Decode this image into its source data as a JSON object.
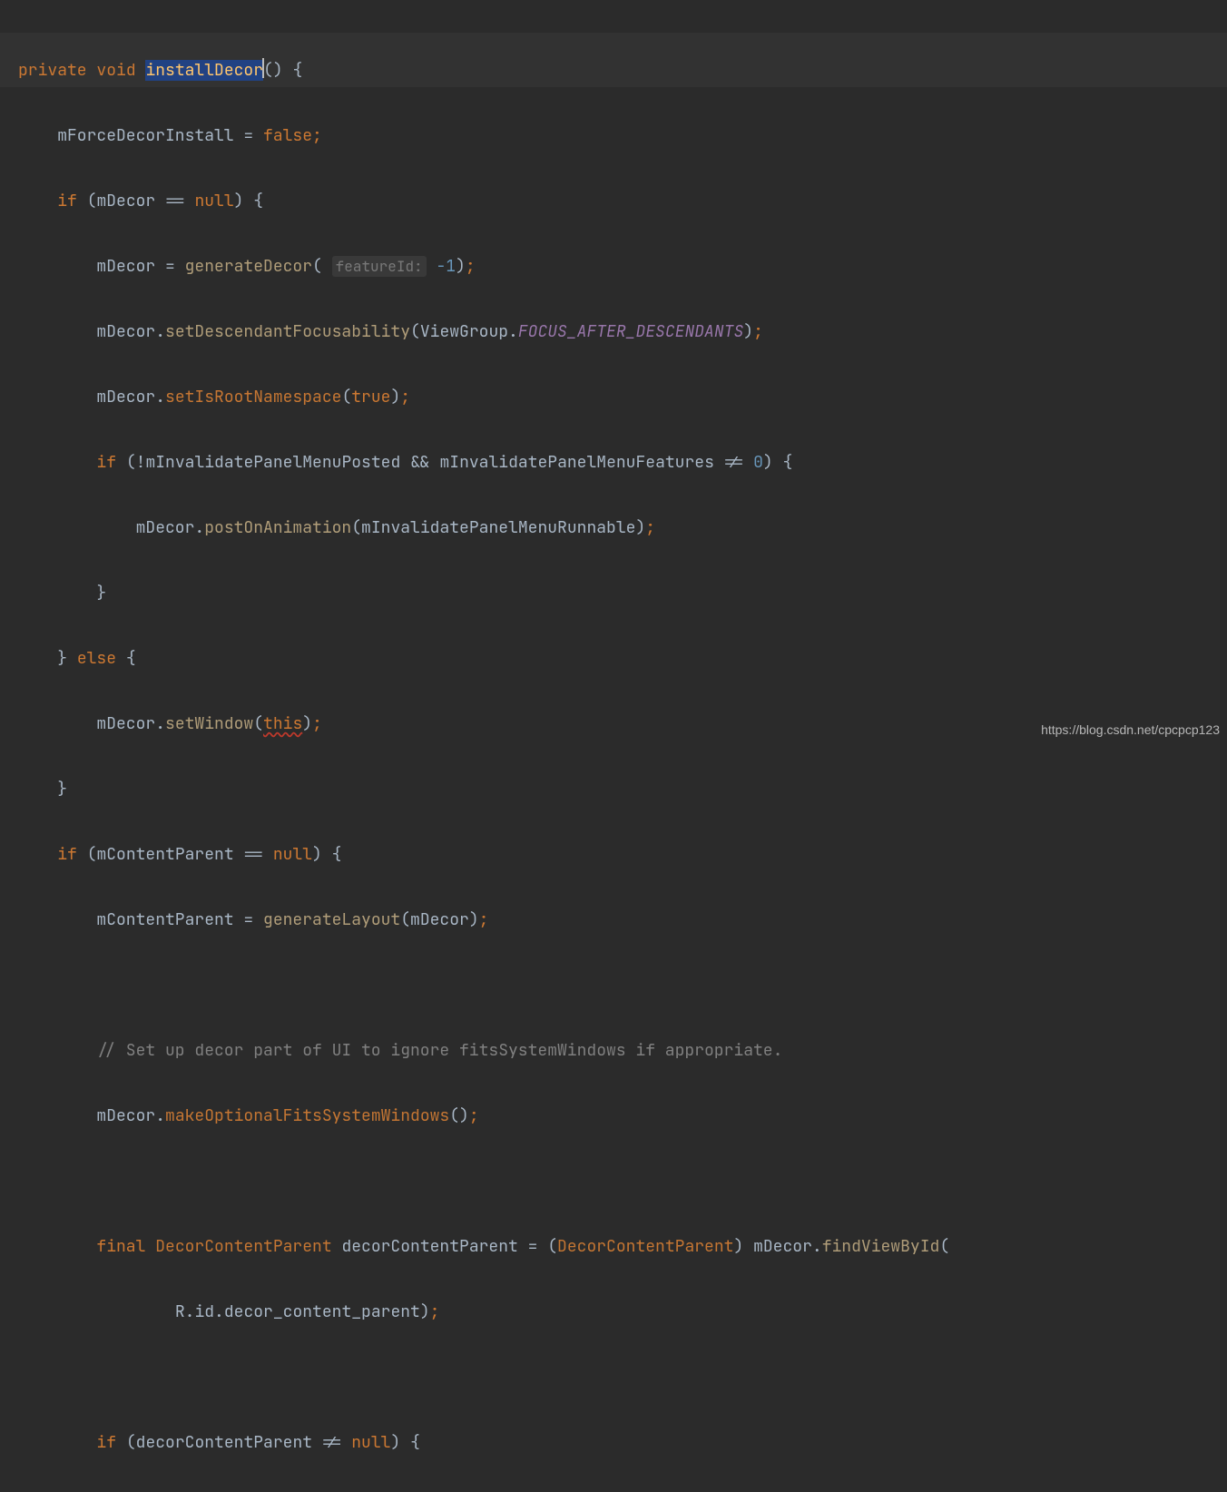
{
  "code": {
    "keyword_private": "private",
    "keyword_void": "void",
    "method_name": "installDecor",
    "open_paren": "()",
    "brace_open": " {",
    "l2_lhs": "mForceDecorInstall",
    "l2_eq": " = ",
    "kw_false": "false",
    "kw_if": "if",
    "kw_else": "else",
    "kw_null": "null",
    "kw_true": "true",
    "kw_this": "this",
    "kw_final": "final",
    "l3_cond_var": "mDecor",
    "l3_cond_op": " == ",
    "l4_lhs": "mDecor",
    "l4_eq": " = ",
    "l4_call": "generateDecor",
    "l4_hint": "featureId:",
    "l4_arg": " -1",
    "l5_obj": "mDecor",
    "l5_dot": ".",
    "l5_call": "setDescendantFocusability",
    "l5_arg_a": "ViewGroup",
    "l5_arg_b": "FOCUS_AFTER_DESCENDANTS",
    "l6_call": "setIsRootNamespace",
    "l7_cond_a": "mInvalidatePanelMenuPosted",
    "l7_op": " && ",
    "l7_cond_b": "mInvalidatePanelMenuFeatures",
    "l7_neq": " != ",
    "l7_zero": "0",
    "l8_call": "postOnAnimation",
    "l8_arg": "mInvalidatePanelMenuRunnable",
    "l11_call": "setWindow",
    "l13_var": "mContentParent",
    "l14_call": "generateLayout",
    "l14_arg": "mDecor",
    "l16_comment": "// Set up decor part of UI to ignore fitsSystemWindows if appropriate.",
    "l17_call": "makeOptionalFitsSystemWindows",
    "l19_type": "DecorContentParent",
    "l19_var": "decorContentParent",
    "l19_cast": "DecorContentParent",
    "l19_call": "findViewById",
    "l20_r": "R",
    "l20_id": "id",
    "l20_field": "decor_content_parent",
    "l22_var": "decorContentParent"
  },
  "watermark": "https://blog.csdn.net/cpcpcp123"
}
